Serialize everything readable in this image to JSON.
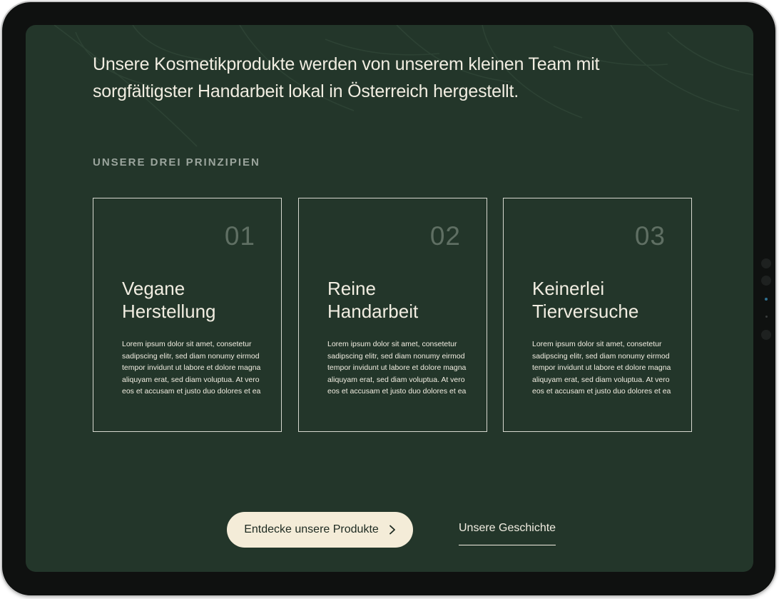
{
  "intro": {
    "text": "Unsere Kosmetikprodukte werden von unserem kleinen Team mit sorgfältigster Handarbeit lokal in Österreich hergestellt."
  },
  "principles": {
    "label": "UNSERE DREI PRINZIPIEN",
    "cards": [
      {
        "number": "01",
        "title_line1": "Vegane",
        "title_line2": "Herstellung",
        "text": "Lorem ipsum dolor sit amet, consetetur sadipscing elitr, sed diam nonumy eirmod tempor invidunt ut labore et dolore magna aliquyam erat, sed diam voluptua. At vero eos et accusam et justo duo dolores et ea"
      },
      {
        "number": "02",
        "title_line1": "Reine",
        "title_line2": "Handarbeit",
        "text": "Lorem ipsum dolor sit amet, consetetur sadipscing elitr, sed diam nonumy eirmod tempor invidunt ut labore et dolore magna aliquyam erat, sed diam voluptua. At vero eos et accusam et justo duo dolores et ea"
      },
      {
        "number": "03",
        "title_line1": "Keinerlei",
        "title_line2": "Tierversuche",
        "text": "Lorem ipsum dolor sit amet, consetetur sadipscing elitr, sed diam nonumy eirmod tempor invidunt ut labore et dolore magna aliquyam erat, sed diam voluptua. At vero eos et accusam et justo duo dolores et ea"
      }
    ]
  },
  "actions": {
    "primary_label": "Entdecke unsere Produkte",
    "primary_icon": "chevron-right-icon",
    "secondary_label": "Unsere Geschichte"
  },
  "colors": {
    "screen_bg": "#23362a",
    "text": "#f1ede1",
    "button_bg": "#f4ecd8",
    "card_number": "#5f6f63"
  }
}
